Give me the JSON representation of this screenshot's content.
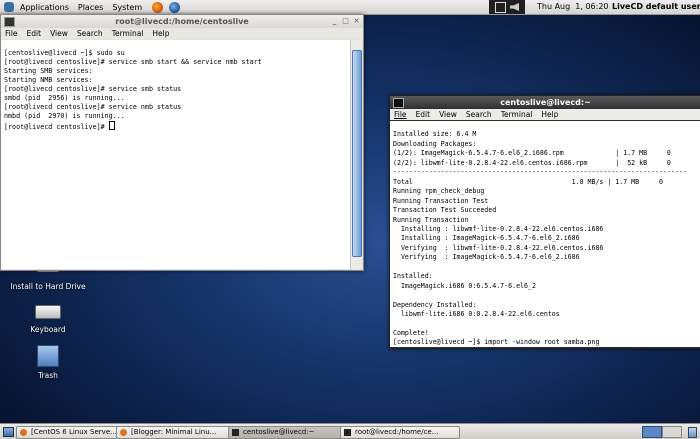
{
  "top_panel": {
    "menus": [
      "Applications",
      "Places",
      "System"
    ],
    "clock": "Thu Aug  1, 06:20",
    "user": "LiveCD default user"
  },
  "desktop": {
    "icons": [
      {
        "label": "Install to Hard Drive"
      },
      {
        "label": "Keyboard"
      },
      {
        "label": "Trash"
      }
    ]
  },
  "window_root": {
    "title": "root@livecd:/home/centoslive",
    "menu": [
      "File",
      "Edit",
      "View",
      "Search",
      "Terminal",
      "Help"
    ],
    "lines": [
      "[centoslive@livecd ~]$ sudo su",
      "[root@livecd centoslive]# service smb start && service nmb start",
      "Starting SMB services:",
      "Starting NMB services:",
      "[root@livecd centoslive]# service smb status",
      "smbd (pid  2956) is running...",
      "[root@livecd centoslive]# service nmb status",
      "nmbd (pid  2970) is running...",
      "[root@livecd centoslive]# "
    ]
  },
  "window_user": {
    "title": "centoslive@livecd:~",
    "menu": [
      "File",
      "Edit",
      "View",
      "Search",
      "Terminal",
      "Help"
    ],
    "lines": [
      "Installed size: 6.4 M",
      "Downloading Packages:",
      "(1/2): ImageMagick-6.5.4.7-6.el6_2.i686.rpm             | 1.7 MB     0",
      "(2/2): libwmf-lite-0.2.8.4-22.el6.centos.i686.rpm       |  52 kB     0",
      "--------------------------------------------------------------------------",
      "Total                                        1.8 MB/s | 1.7 MB     0",
      "Running rpm_check_debug",
      "Running Transaction Test",
      "Transaction Test Succeeded",
      "Running Transaction",
      "  Installing : libwmf-lite-0.2.8.4-22.el6.centos.i686",
      "  Installing : ImageMagick-6.5.4.7-6.el6_2.i686",
      "  Verifying  : libwmf-lite-0.2.8.4-22.el6.centos.i686",
      "  Verifying  : ImageMagick-6.5.4.7-6.el6_2.i686",
      "",
      "Installed:",
      "  ImageMagick.i686 0:6.5.4.7-6.el6_2",
      "",
      "Dependency Installed:",
      "  libwmf-lite.i686 0:0.2.8.4-22.el6.centos",
      "",
      "Complete!",
      "[centoslive@livecd ~]$ import -window root samba.png"
    ]
  },
  "taskbar": {
    "tasks": [
      {
        "label": "[CentOS 6 Linux Serve..."
      },
      {
        "label": "[Blogger: Minimal Linu..."
      },
      {
        "label": "centoslive@livecd:~"
      },
      {
        "label": "root@livecd:/home/ce..."
      }
    ]
  },
  "colors": {
    "desktop_blue": "#143266",
    "active_title": "#3d3d3d",
    "inactive_title": "#e4e3e0"
  }
}
